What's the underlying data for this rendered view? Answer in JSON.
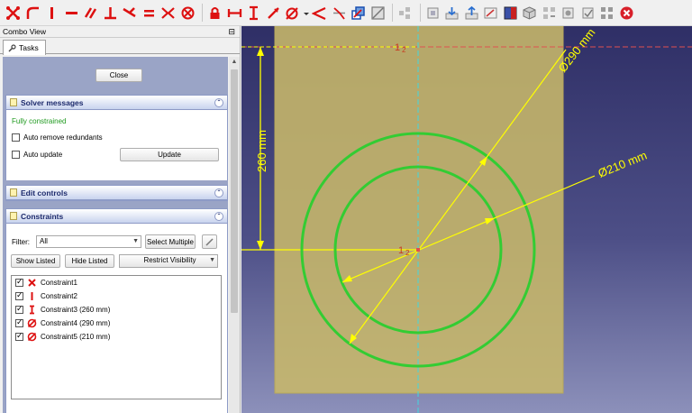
{
  "toolbar": {
    "icons": [
      "point-icon",
      "fillet-icon",
      "vertical-icon",
      "horizontal-icon",
      "parallel-icon",
      "perpendicular-icon",
      "tangent-icon",
      "equal-icon",
      "symmetric-icon",
      "block-icon",
      "lock-icon",
      "horizontal-distance-icon",
      "vertical-distance-icon",
      "distance-icon",
      "radius-diameter-icon",
      "angle-icon",
      "snell-icon",
      "toggle-driving-icon",
      "toggle-active-icon",
      "clone-icon",
      "close-sketch-icon"
    ]
  },
  "panel": {
    "title": "Combo View",
    "float_icon": "⊟",
    "tab_label": "Tasks",
    "close_label": "Close",
    "solver": {
      "header": "Solver messages",
      "status": "Fully constrained",
      "status_color": "#1f9a1f",
      "auto_remove_label": "Auto remove redundants",
      "auto_update_label": "Auto update",
      "update_label": "Update"
    },
    "edit_controls": {
      "header": "Edit controls"
    },
    "constraints": {
      "header": "Constraints",
      "filter_label": "Filter:",
      "filter_value": "All",
      "select_multiple_label": "Select Multiple",
      "show_listed_label": "Show Listed",
      "hide_listed_label": "Hide Listed",
      "restrict_visibility_label": "Restrict Visibility",
      "items": [
        {
          "label": "Constraint1",
          "icon": "coincident-icon"
        },
        {
          "label": "Constraint2",
          "icon": "vertical-icon"
        },
        {
          "label": "Constraint3 (260 mm)",
          "icon": "vertical-distance-icon"
        },
        {
          "label": "Constraint4 (290 mm)",
          "icon": "diameter-icon"
        },
        {
          "label": "Constraint5 (210 mm)",
          "icon": "diameter-icon"
        }
      ]
    }
  },
  "viewport": {
    "dim_vertical": "260 mm",
    "dim_d290": "Ø290 mm",
    "dim_d210": "Ø210 mm",
    "sketch_color": "#33cc33",
    "dimension_color": "#ffff00",
    "face_color": "#c8b86a",
    "axis_label_top": "1",
    "axis_label_center": "1",
    "axis_suffix": "2"
  }
}
